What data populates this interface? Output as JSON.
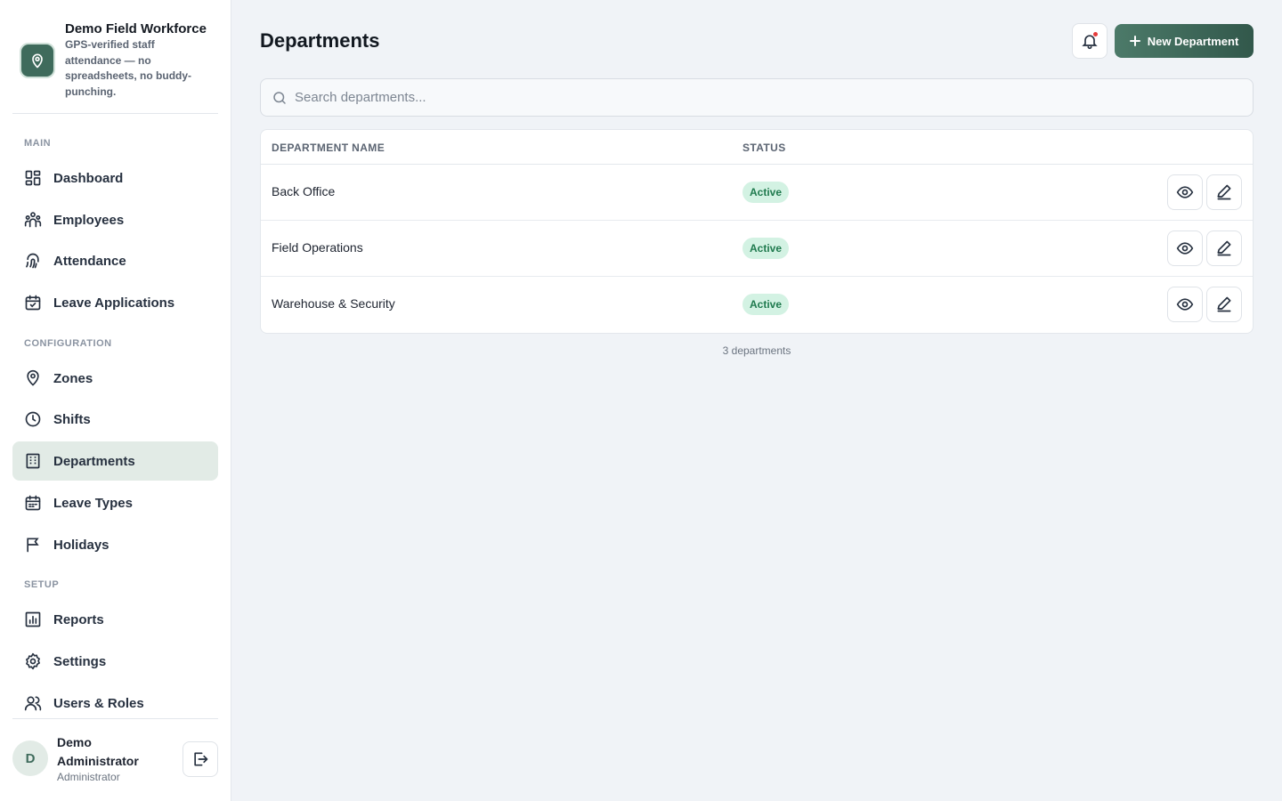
{
  "brand": {
    "title": "Demo Field Workforce",
    "subtitle": "GPS-verified staff attendance — no spreadsheets, no buddy-punching."
  },
  "sidebar": {
    "sections": [
      {
        "label": "MAIN"
      },
      {
        "label": "CONFIGURATION"
      },
      {
        "label": "SETUP"
      }
    ],
    "items": [
      {
        "label": "Dashboard",
        "icon": "dashboard-icon"
      },
      {
        "label": "Employees",
        "icon": "employees-icon"
      },
      {
        "label": "Attendance",
        "icon": "fingerprint-icon"
      },
      {
        "label": "Leave Applications",
        "icon": "calendar-check-icon"
      },
      {
        "label": "Zones",
        "icon": "map-pin-icon"
      },
      {
        "label": "Shifts",
        "icon": "clock-icon"
      },
      {
        "label": "Departments",
        "icon": "building-icon",
        "active": true
      },
      {
        "label": "Leave Types",
        "icon": "calendar-icon"
      },
      {
        "label": "Holidays",
        "icon": "flag-icon"
      },
      {
        "label": "Reports",
        "icon": "bar-chart-icon"
      },
      {
        "label": "Settings",
        "icon": "gear-icon"
      },
      {
        "label": "Users & Roles",
        "icon": "users-icon"
      }
    ]
  },
  "user": {
    "initial": "D",
    "name": "Demo Administrator",
    "role": "Administrator"
  },
  "header": {
    "title": "Departments",
    "new_button": "New Department"
  },
  "search": {
    "placeholder": "Search departments..."
  },
  "table": {
    "columns": [
      "DEPARTMENT NAME",
      "STATUS"
    ],
    "rows": [
      {
        "name": "Back Office",
        "status": "Active"
      },
      {
        "name": "Field Operations",
        "status": "Active"
      },
      {
        "name": "Warehouse & Security",
        "status": "Active"
      }
    ],
    "footer": "3 departments"
  },
  "colors": {
    "accent": "#3f6b5c",
    "active_nav_bg": "#e2ebe6",
    "badge_bg": "#d3f2e3",
    "badge_text": "#1f7a4e",
    "notification_dot": "#e53b3b"
  }
}
